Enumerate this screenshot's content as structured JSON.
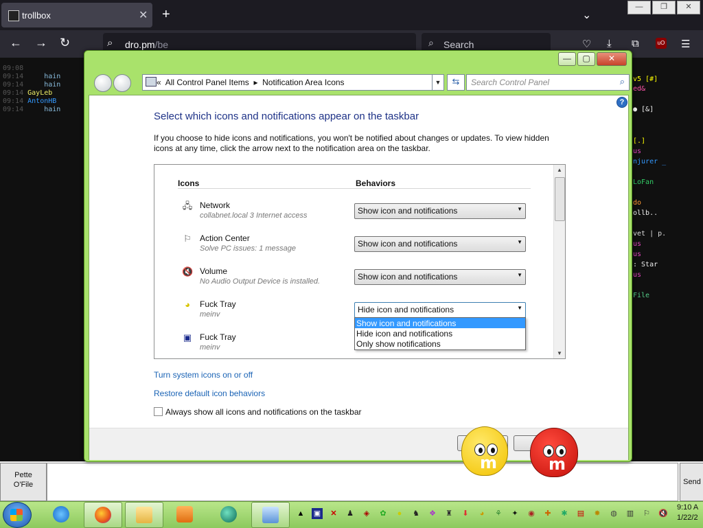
{
  "browser": {
    "tab": {
      "title": "trollbox",
      "close": "✕"
    },
    "new_tab": "+",
    "list_tabs": "⌄",
    "window_controls": [
      "—",
      "❐",
      "✕"
    ],
    "url_host": "dro.pm",
    "url_path": "/be",
    "search_placeholder": "Search"
  },
  "chat_left": [
    {
      "time": "09:08",
      "text": ""
    },
    {
      "time": "09:14",
      "text": "    hain"
    },
    {
      "time": "09:14",
      "text": "    hain"
    },
    {
      "time": "09:14",
      "text": "GayLeb"
    },
    {
      "time": "09:14",
      "text": "AntonHB"
    },
    {
      "time": "09:14",
      "text": "    hain"
    }
  ],
  "chat_right": [
    "v5 [#]",
    "ed&",
    "● [&]",
    "[.]",
    "us",
    "njurer _",
    "LoFan",
    "do",
    "ollb..",
    "vet | p.",
    "us",
    "us",
    ": Star",
    "us",
    "File"
  ],
  "chat_input": {
    "nick_line1": "Pette",
    "nick_line2": "O'File",
    "send": "Send"
  },
  "control_panel": {
    "breadcrumb_prefix": "«",
    "breadcrumb_1": "All Control Panel Items",
    "breadcrumb_sep": "▸",
    "breadcrumb_2": "Notification Area Icons",
    "search_placeholder": "Search Control Panel",
    "caption_buttons": [
      "—",
      "▢",
      "✕"
    ],
    "heading": "Select which icons and notifications appear on the taskbar",
    "description": "If you choose to hide icons and notifications, you won't be notified about changes or updates. To view hidden icons at any time, click the arrow next to the notification area on the taskbar.",
    "col_icons": "Icons",
    "col_behaviors": "Behaviors",
    "rows": [
      {
        "name": "Network",
        "sub": "collabnet.local  3 Internet access",
        "behavior": "Show icon and notifications",
        "icon": "network-icon"
      },
      {
        "name": "Action Center",
        "sub": "Solve PC issues: 1 message",
        "behavior": "Show icon and notifications",
        "icon": "action-center-flag-icon"
      },
      {
        "name": "Volume",
        "sub": "No Audio Output Device is installed.",
        "behavior": "Show icon and notifications",
        "icon": "volume-muted-icon"
      },
      {
        "name": "Fuck Tray",
        "sub": "meinv",
        "behavior": "Hide icon and notifications",
        "icon": "tray-app-icon"
      },
      {
        "name": "Fuck Tray",
        "sub": "meinv",
        "behavior": "",
        "icon": "tray-app-icon-2"
      }
    ],
    "dropdown_options": [
      "Show icon and notifications",
      "Hide icon and notifications",
      "Only show notifications"
    ],
    "dropdown_selected_index": 0,
    "link_system_icons": "Turn system icons on or off",
    "link_restore": "Restore default icon behaviors",
    "always_show_label": "Always show all icons and notifications on the taskbar",
    "ok_label": "OK",
    "cancel_label": "Ca"
  },
  "taskbar": {
    "apps": [
      "internet-explorer",
      "firefox",
      "file-explorer",
      "media-player",
      "app-green-orb",
      "control-panel"
    ],
    "clock_time": "9:10 A",
    "clock_date": "1/22/2"
  },
  "colors": {
    "window_frame": "#a9e26b",
    "heading": "#1e3287",
    "link": "#1a63b5",
    "selection": "#3399ff",
    "taskbar": "#9bd36a"
  }
}
